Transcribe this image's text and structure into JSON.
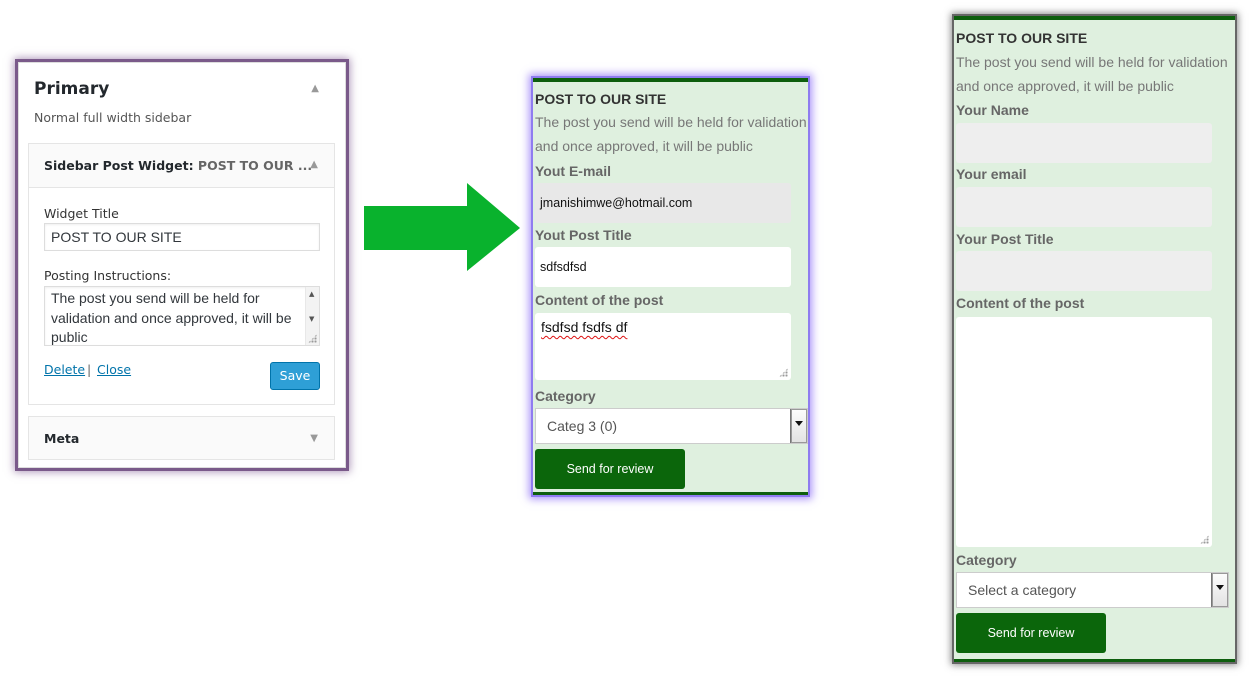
{
  "admin": {
    "area_title": "Primary",
    "area_desc": "Normal full width sidebar",
    "widget": {
      "name": "Sidebar Post Widget",
      "name_sep": ": ",
      "title_preview": "POST TO OUR ...",
      "title_label": "Widget Title",
      "title_value": "POST TO OUR SITE",
      "instructions_label": "Posting Instructions:",
      "instructions_value": "The post you send will be held for validation and once approved, it will be public",
      "delete_label": "Delete",
      "separator": "|",
      "close_label": "Close",
      "save_label": "Save"
    },
    "meta_widget": {
      "name": "Meta"
    },
    "icons": {
      "collapse": "triangle-up-icon",
      "expand": "triangle-down-icon"
    }
  },
  "arrow": {
    "color": "#09b22d",
    "icon": "right-arrow-icon"
  },
  "form_filled": {
    "title": "POST TO OUR SITE",
    "description": "The post you send will be held for validation and once approved, it will be public",
    "email_label": "Yout E-mail",
    "email_value": "jmanishimwe@hotmail.com",
    "post_title_label": "Yout Post Title",
    "post_title_value": "sdfsdfsd",
    "content_label": "Content of the post",
    "content_value": "fsdfsd fsdfs df",
    "category_label": "Category",
    "category_value": "Categ 3  (0)",
    "submit_label": "Send for review"
  },
  "form_empty": {
    "title": "POST TO OUR SITE",
    "description": "The post you send will be held for validation and once approved, it will be public",
    "name_label": "Your Name",
    "email_label": "Your email",
    "post_title_label": "Your Post Title",
    "content_label": "Content of the post",
    "category_label": "Category",
    "category_placeholder": "Select a category",
    "submit_label": "Send for review"
  },
  "colors": {
    "form_bg": "#dff0df",
    "form_border": "#0d5e0d",
    "button_green": "#0b660b",
    "wp_button_blue": "#2e9fd6",
    "link_blue": "#0073aa",
    "highlight_purple": "#8f7cf0"
  }
}
